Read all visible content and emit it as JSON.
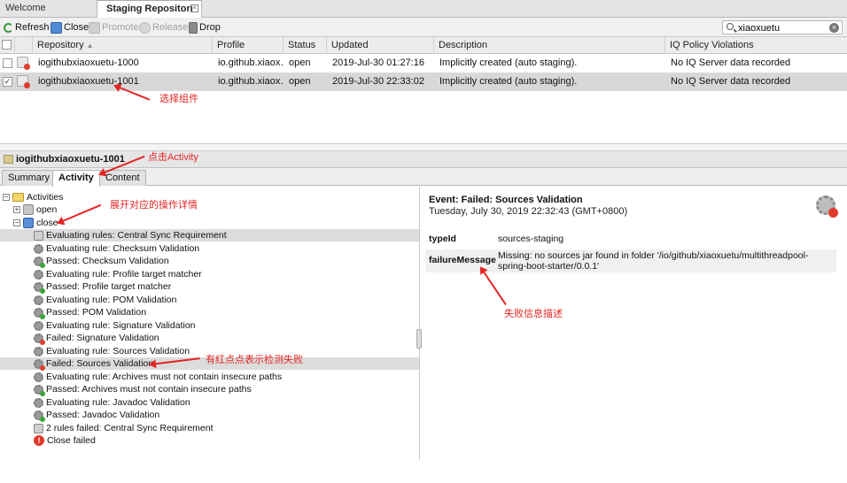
{
  "tabs": {
    "welcome": "Welcome",
    "staging": "Staging Repositori"
  },
  "toolbar": {
    "refresh": "Refresh",
    "close": "Close",
    "promote": "Promote",
    "release": "Release",
    "drop": "Drop",
    "search_value": "xiaoxuetu"
  },
  "grid": {
    "columns": [
      "Repository",
      "Profile",
      "Status",
      "Updated",
      "Description",
      "IQ Policy Violations"
    ],
    "rows": [
      {
        "checked": false,
        "repository": "iogithubxiaoxuetu-1000",
        "profile": "io.github.xiaox…",
        "status": "open",
        "updated": "2019-Jul-30 01:27:16",
        "description": "Implicitly created (auto staging).",
        "iq": "No IQ Server data recorded"
      },
      {
        "checked": true,
        "repository": "iogithubxiaoxuetu-1001",
        "profile": "io.github.xiaox…",
        "status": "open",
        "updated": "2019-Jul-30 22:33:02",
        "description": "Implicitly created (auto staging).",
        "iq": "No IQ Server data recorded"
      }
    ]
  },
  "detail": {
    "title": "iogithubxiaoxuetu-1001",
    "tabs": {
      "summary": "Summary",
      "activity": "Activity",
      "content": "Content"
    }
  },
  "tree": {
    "root": "Activities",
    "open": "open",
    "close": "close",
    "items": [
      {
        "label": "Evaluating rules: Central Sync Requirement",
        "icon": "rule"
      },
      {
        "label": "Evaluating rule: Checksum Validation",
        "icon": "gear"
      },
      {
        "label": "Passed: Checksum Validation",
        "icon": "gear-ok"
      },
      {
        "label": "Evaluating rule: Profile target matcher",
        "icon": "gear"
      },
      {
        "label": "Passed: Profile target matcher",
        "icon": "gear-ok"
      },
      {
        "label": "Evaluating rule: POM Validation",
        "icon": "gear"
      },
      {
        "label": "Passed: POM Validation",
        "icon": "gear-ok"
      },
      {
        "label": "Evaluating rule: Signature Validation",
        "icon": "gear"
      },
      {
        "label": "Failed: Signature Validation",
        "icon": "gear-bad"
      },
      {
        "label": "Evaluating rule: Sources Validation",
        "icon": "gear"
      },
      {
        "label": "Failed: Sources Validation",
        "icon": "gear-bad"
      },
      {
        "label": "Evaluating rule: Archives must not contain insecure paths",
        "icon": "gear"
      },
      {
        "label": "Passed: Archives must not contain insecure paths",
        "icon": "gear-ok"
      },
      {
        "label": "Evaluating rule: Javadoc Validation",
        "icon": "gear"
      },
      {
        "label": "Passed: Javadoc Validation",
        "icon": "gear-ok"
      },
      {
        "label": "2 rules failed: Central Sync Requirement",
        "icon": "rule"
      },
      {
        "label": "Close failed",
        "icon": "error"
      }
    ]
  },
  "event": {
    "title": "Event: Failed: Sources Validation",
    "date": "Tuesday, July 30, 2019 22:32:43 (GMT+0800)",
    "props": [
      {
        "key": "typeId",
        "value": "sources-staging"
      },
      {
        "key": "failureMessage",
        "value": "Missing: no sources jar found in folder '/io/github/xiaoxuetu/multithreadpool-spring-boot-starter/0.0.1'"
      }
    ]
  },
  "annotations": {
    "select_component": "选择组件",
    "click_activity": "点击Activity",
    "expand_details": "展开对应的操作详情",
    "red_dot_failed": "有红点点表示检测失败",
    "failure_desc": "失败信息描述"
  }
}
